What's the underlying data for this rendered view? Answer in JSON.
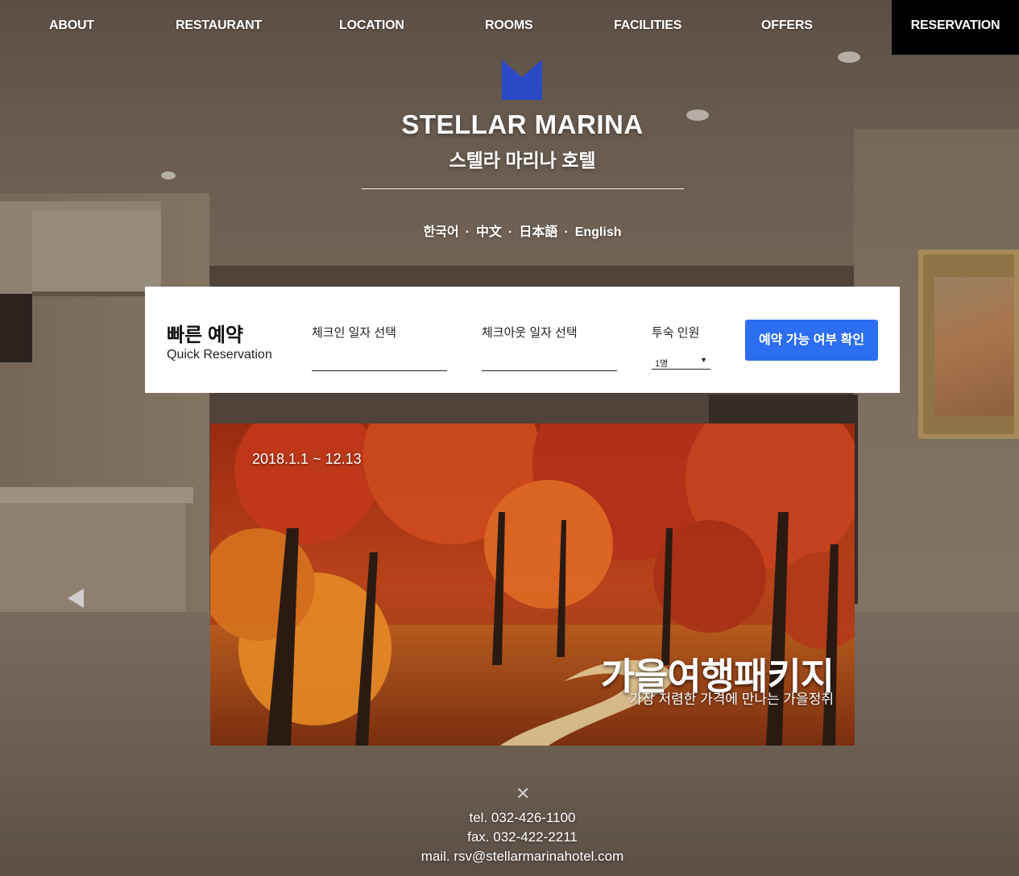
{
  "nav": {
    "items": [
      {
        "label": "ABOUT"
      },
      {
        "label": "RESTAURANT"
      },
      {
        "label": "LOCATION"
      },
      {
        "label": "ROOMS"
      },
      {
        "label": "FACILITIES"
      },
      {
        "label": "OFFERS"
      },
      {
        "label": "RESERVATION",
        "active": true
      }
    ]
  },
  "brand": {
    "logo_icon": "blue-m-logo-icon",
    "logo_color": "#2b49c8",
    "title_en": "STELLAR MARINA",
    "title_ko": "스텔라 마리나 호텔"
  },
  "languages": [
    "한국어",
    "中文",
    "日本語",
    "English"
  ],
  "language_separator": "·",
  "quick_reservation": {
    "title": "빠른 예약",
    "subtitle": "Quick Reservation",
    "checkin_label": "체크인 일자 선택",
    "checkout_label": "체크아웃 일자 선택",
    "guests_label": "투숙 인원",
    "guests_value": "1명",
    "guests_caret": "▼",
    "submit_label": "예약 가능 여부 확인",
    "accent": "#2b6ef1"
  },
  "banner": {
    "date": "2018.1.1 ~ 12.13",
    "title": "가을여행패키지",
    "subtitle": "가장 저렴한 가격에 만나는 가을정취"
  },
  "controls": {
    "prev_icon": "triangle-left-icon",
    "close_icon": "close-icon",
    "close_glyph": "✕"
  },
  "contact": {
    "tel": "tel. 032-426-1100",
    "fax": "fax. 032-422-2211",
    "mail": "mail. rsv@stellarmarinahotel.com"
  }
}
